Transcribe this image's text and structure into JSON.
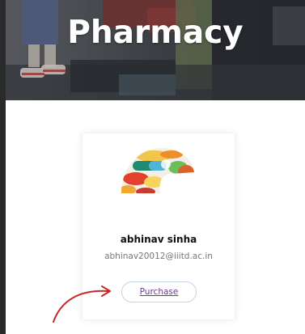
{
  "hero": {
    "title": "Pharmacy"
  },
  "card": {
    "image_icon": "pills-icon",
    "name": "abhinav sinha",
    "email": "abhinav20012@iiitd.ac.in",
    "button_label": "Purchase"
  },
  "colors": {
    "link_purple": "#6a3d8f",
    "arrow_red": "#c62828",
    "button_border": "#c5d3e3"
  }
}
